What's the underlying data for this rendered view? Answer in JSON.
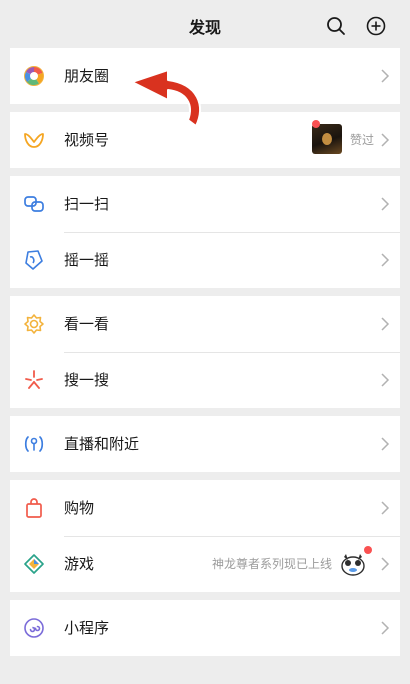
{
  "header": {
    "title": "发现"
  },
  "groups": {
    "moments": {
      "label": "朋友圈"
    },
    "channels": {
      "label": "视频号",
      "badge_text": "赞过"
    },
    "scan": {
      "label": "扫一扫"
    },
    "shake": {
      "label": "摇一摇"
    },
    "top_stories": {
      "label": "看一看"
    },
    "search": {
      "label": "搜一搜"
    },
    "live_nearby": {
      "label": "直播和附近"
    },
    "shopping": {
      "label": "购物"
    },
    "games": {
      "label": "游戏",
      "promo_text": "神龙尊者系列现已上线"
    },
    "mini_programs": {
      "label": "小程序"
    }
  },
  "colors": {
    "background": "#ededed",
    "card": "#ffffff",
    "text": "#191919",
    "secondary_text": "#9b9b9b",
    "badge_red": "#fa5151",
    "annotation_arrow": "#d9321f"
  },
  "icons": {
    "header_search": "search-icon",
    "header_add": "plus-circle-icon",
    "moments": "moments-aperture-icon",
    "channels": "channels-icon",
    "scan": "scan-icon",
    "shake": "shake-icon",
    "top_stories": "top-stories-icon",
    "search": "search-sparkle-icon",
    "live_nearby": "live-nearby-icon",
    "shopping": "shopping-bag-icon",
    "games": "games-diamond-icon",
    "mini_programs": "mini-program-icon"
  }
}
